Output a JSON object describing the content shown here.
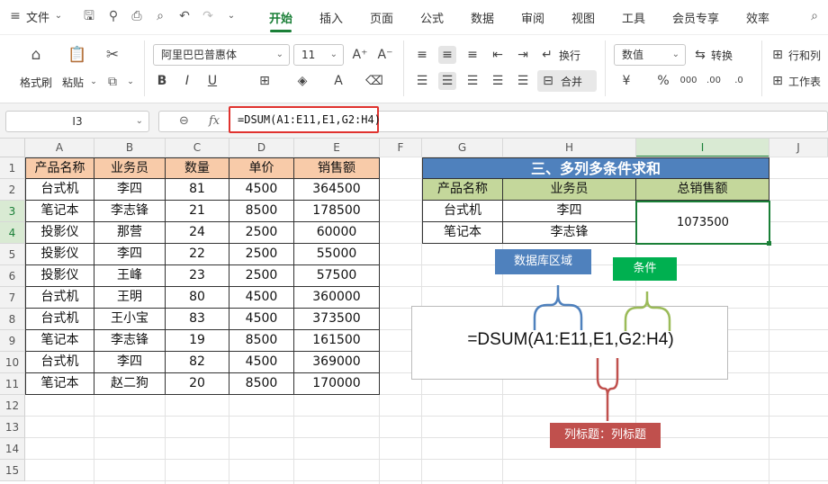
{
  "menubar": {
    "file_label": "文件",
    "tabs": [
      "开始",
      "插入",
      "页面",
      "公式",
      "数据",
      "审阅",
      "视图",
      "工具",
      "会员专享",
      "效率"
    ],
    "active_tab": "开始"
  },
  "ribbon": {
    "format_painter": "格式刷",
    "paste": "粘贴",
    "font_name": "阿里巴巴普惠体",
    "font_size": "11",
    "wrap": "换行",
    "merge": "合并",
    "number_format": "数值",
    "convert": "转换",
    "rows_cols": "行和列",
    "sheet": "工作表"
  },
  "formula_bar": {
    "cell_ref": "I3",
    "fx": "fx",
    "formula": "=DSUM(A1:E11,E1,G2:H4)"
  },
  "columns": [
    "A",
    "B",
    "C",
    "D",
    "E",
    "F",
    "G",
    "H",
    "I",
    "J"
  ],
  "rows": [
    "1",
    "2",
    "3",
    "4",
    "5",
    "6",
    "7",
    "8",
    "9",
    "10",
    "11",
    "12",
    "13",
    "14",
    "15"
  ],
  "table_main": {
    "headers": [
      "产品名称",
      "业务员",
      "数量",
      "单价",
      "销售额"
    ],
    "rows": [
      [
        "台式机",
        "李四",
        "81",
        "4500",
        "364500"
      ],
      [
        "笔记本",
        "李志锋",
        "21",
        "8500",
        "178500"
      ],
      [
        "投影仪",
        "那营",
        "24",
        "2500",
        "60000"
      ],
      [
        "投影仪",
        "李四",
        "22",
        "2500",
        "55000"
      ],
      [
        "投影仪",
        "王峰",
        "23",
        "2500",
        "57500"
      ],
      [
        "台式机",
        "王明",
        "80",
        "4500",
        "360000"
      ],
      [
        "台式机",
        "王小宝",
        "83",
        "4500",
        "373500"
      ],
      [
        "笔记本",
        "李志锋",
        "19",
        "8500",
        "161500"
      ],
      [
        "台式机",
        "李四",
        "82",
        "4500",
        "369000"
      ],
      [
        "笔记本",
        "赵二狗",
        "20",
        "8500",
        "170000"
      ]
    ]
  },
  "criteria": {
    "title": "三、多列多条件求和",
    "headers": [
      "产品名称",
      "业务员",
      "总销售额"
    ],
    "rows": [
      [
        "台式机",
        "李四"
      ],
      [
        "笔记本",
        "李志锋"
      ]
    ],
    "result": "1073500"
  },
  "annotations": {
    "database": "数据库区域",
    "condition": "条件",
    "column_title": "列标题：列标题",
    "formula_display": "=DSUM(A1:E11,E1,G2:H4)"
  },
  "colors": {
    "accent_green": "#1a7f37",
    "header_fill": "#f8cba9",
    "title_fill": "#4f81bd",
    "criteria_header_fill": "#c4d79b",
    "database_label": "#4f81bd",
    "condition_label": "#00b050",
    "column_label": "#c0504d",
    "formula_highlight": "#e0332f"
  }
}
